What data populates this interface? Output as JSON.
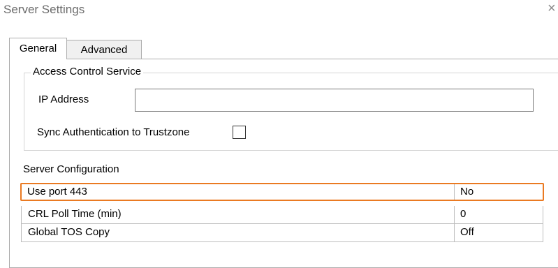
{
  "window": {
    "title": "Server Settings",
    "close_glyph": "×"
  },
  "tabs": [
    {
      "label": "General",
      "selected": true
    },
    {
      "label": "Advanced",
      "selected": false
    }
  ],
  "access_control": {
    "legend": "Access Control Service",
    "ip_label": "IP Address",
    "ip_value": "",
    "sync_label": "Sync Authentication to Trustzone",
    "sync_checked": false
  },
  "server_config": {
    "heading": "Server Configuration",
    "rows": [
      {
        "name": "Use port 443",
        "value": "No",
        "highlighted": true
      },
      {
        "name": "CRL Poll Time (min)",
        "value": "0",
        "highlighted": false
      },
      {
        "name": "Global TOS Copy",
        "value": "Off",
        "highlighted": false
      }
    ]
  },
  "colors": {
    "highlight_border": "#ea7a22",
    "title_text": "#6b6b6b"
  }
}
